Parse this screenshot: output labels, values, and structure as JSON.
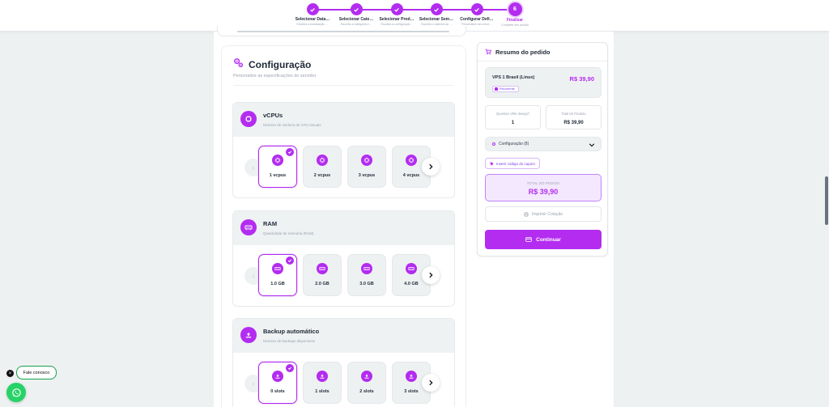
{
  "stepper": {
    "steps": [
      {
        "label": "Selecionar Data…",
        "sub": "Escolha a localização …"
      },
      {
        "label": "Selecionar Cate…",
        "sub": "Escolha a categoria d…"
      },
      {
        "label": "Selecionar Prod…",
        "sub": "Escolha a configuraçã…"
      },
      {
        "label": "Selecionar Sem…",
        "sub": "Escolha o sistema op…"
      },
      {
        "label": "Configurar Defi…",
        "sub": "Personalize seu servi…"
      },
      {
        "label": "Finalizar",
        "sub": "Complete seu pedido",
        "number": "6"
      }
    ]
  },
  "config": {
    "title": "Configuração",
    "subtitle": "Personalize as especificações do servidor",
    "sections": [
      {
        "title": "vCPUs",
        "subtitle": "Número de núcleos de CPU virtuais",
        "options": [
          "1 vcpus",
          "2 vcpus",
          "3 vcpus",
          "4 vcpus"
        ]
      },
      {
        "title": "RAM",
        "subtitle": "Quantidade de memória (RAM)",
        "options": [
          "1.0 GB",
          "2.0 GB",
          "3.0 GB",
          "4.0 GB"
        ]
      },
      {
        "title": "Backup automático",
        "subtitle": "Número de backups disponíveis",
        "options": [
          "0 slots",
          "1 slots",
          "2 slots",
          "3 slots"
        ]
      }
    ]
  },
  "summary": {
    "title": "Resumo do pedido",
    "product_name": "VPS 1 Brasil (Linux)",
    "product_price": "R$ 39,90",
    "product_badge": "Recorrente",
    "qty_label": "Quantas VMs deseja?",
    "qty_value": "1",
    "total_label": "Total do Produto",
    "total_value": "R$ 39,90",
    "config_label": "Configuração (8)",
    "coupon_label": "Inserir código do cupom",
    "order_total_label": "TOTAL DO PEDIDO",
    "order_total_value": "R$ 39,90",
    "print_label": "Imprimir Cotação",
    "continue_label": "Continuar"
  },
  "chat": {
    "bubble": "Fale conosco",
    "close": "×"
  },
  "colors": {
    "accent": "#b32cf0",
    "whatsapp": "#25d366"
  }
}
